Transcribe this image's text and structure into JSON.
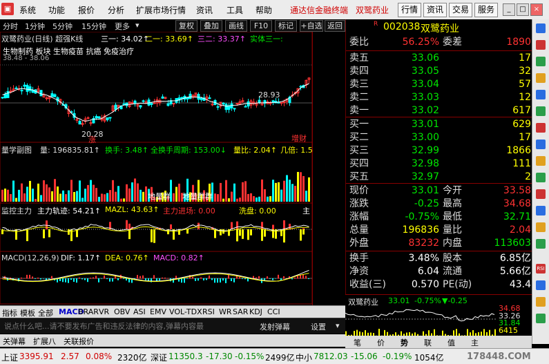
{
  "menu": {
    "items": [
      "系统",
      "功能",
      "报价",
      "分析",
      "扩展市场行情",
      "资讯",
      "工具",
      "帮助"
    ],
    "brand_text": "通达信金融终端",
    "stock_title": "双鹭药业",
    "buttons": [
      "行情",
      "资讯",
      "交易",
      "服务"
    ]
  },
  "toolbar2": {
    "periods": [
      "分时",
      "1分钟",
      "5分钟",
      "15分钟",
      "更多"
    ],
    "buttons": [
      "复权",
      "叠加",
      "画线",
      "F10",
      "标记",
      "+自选",
      "返回"
    ]
  },
  "chart": {
    "header": "双鹭药业(日线) 超强K线",
    "ma1": "三一: 34.02↑",
    "ma2": "二一: 33.69↑",
    "ma3": "三二: 33.37↑",
    "ma4": "实体三一:",
    "concept": "生物制药 板块 生物疫苗 抗癌 免疫治疗",
    "price_range": "38.48 - 38.06",
    "marker_high": "28.93",
    "marker_low": "20.28",
    "tag1": "涨",
    "tag2": "增财",
    "sub1_title": "量学副图",
    "sub1_vol": "量: 196835.81↑",
    "sub1_turnover": "换手: 3.48↑",
    "sub1_cycle": "全换手周期: 153.00↓",
    "sub1_ratio": "量比: 2.04↑",
    "sub1_multiple": "几倍: 1.5",
    "sub1_note1": "地量群",
    "sub1_note2": "地量群群",
    "sub2_title": "监控主力",
    "sub2_trace": "主力轨迹: 54.21↑",
    "sub2_mazl": "MAZL: 43.63↑",
    "sub2_enter": "主力进场: 0.00",
    "sub2_wash": "洗盘: 0.00",
    "sub2_main": "主",
    "macd_title": "MACD(12,26,9)",
    "macd_dif": "DIF: 1.17↑",
    "macd_dea": "DEA: 0.76↑",
    "macd_val": "MACD: 0.82↑",
    "date_label": "日线"
  },
  "colors": {
    "up": "#ff3232",
    "down": "#00ffff",
    "green": "#00e600",
    "yellow": "#ffff00",
    "magenta": "#ff50ff",
    "white": "#ffffff"
  },
  "quote": {
    "code": "002038",
    "name": "双鹭药业",
    "weibi_label": "委比",
    "weibi": "56.25%",
    "weicha_label": "委差",
    "weicha": "1890",
    "asks": [
      {
        "label": "卖五",
        "price": "33.06",
        "vol": "17"
      },
      {
        "label": "卖四",
        "price": "33.05",
        "vol": "32"
      },
      {
        "label": "卖三",
        "price": "33.04",
        "vol": "57"
      },
      {
        "label": "卖二",
        "price": "33.03",
        "vol": "12"
      },
      {
        "label": "卖一",
        "price": "33.02",
        "vol": "617"
      }
    ],
    "bids": [
      {
        "label": "买一",
        "price": "33.01",
        "vol": "629"
      },
      {
        "label": "买二",
        "price": "33.00",
        "vol": "17"
      },
      {
        "label": "买三",
        "price": "32.99",
        "vol": "1866"
      },
      {
        "label": "买四",
        "price": "32.98",
        "vol": "111"
      },
      {
        "label": "买五",
        "price": "32.97",
        "vol": "2"
      }
    ],
    "stats": [
      {
        "l1": "现价",
        "v1": "33.01",
        "l2": "今开",
        "v2": "33.58"
      },
      {
        "l1": "涨跌",
        "v1": "-0.25",
        "l2": "最高",
        "v2": "34.68"
      },
      {
        "l1": "涨幅",
        "v1": "-0.75%",
        "l2": "最低",
        "v2": "32.71"
      },
      {
        "l1": "总量",
        "v1": "196836",
        "l2": "量比",
        "v2": "2.04"
      },
      {
        "l1": "外盘",
        "v1": "83232",
        "l2": "内盘",
        "v2": "113603"
      }
    ],
    "finance": [
      {
        "l1": "换手",
        "v1": "3.48%",
        "l2": "股本",
        "v2": "6.85亿"
      },
      {
        "l1": "净资",
        "v1": "6.04",
        "l2": "流通",
        "v2": "5.66亿"
      },
      {
        "l1": "收益(三)",
        "v1": "0.570",
        "l2": "PE(动)",
        "v2": "43.4"
      }
    ],
    "mini_title": "双鹭药业",
    "mini_price": "33.01",
    "mini_pct": "-0.75%",
    "mini_change": "▼-0.25",
    "mini_high": "34.68",
    "mini_mid": "33.26",
    "mini_low": "31.84",
    "mini_vol": "6415",
    "mini_tabs": [
      "笔",
      "价",
      "势",
      "联",
      "值",
      "主"
    ]
  },
  "bottom": {
    "tabs": [
      "指标",
      "模板",
      "全部",
      "MACD",
      "BRAR",
      "VR",
      "OBV",
      "ASI",
      "EMV",
      "VOL-TDX",
      "RSI",
      "WR",
      "SAR",
      "KDJ",
      "CCI"
    ],
    "comment_placeholder": "说点什么吧...请不要发布广告和违反法律的内容,弹幕内容最",
    "send_btn": "发射弹幕",
    "settings": "设置",
    "bar2": [
      "关弹幕",
      "扩展八",
      "关联报价"
    ]
  },
  "status": {
    "sh_label": "上证",
    "sh_index": "3395.91",
    "sh_change": "2.57",
    "sh_pct": "0.08%",
    "sh_amount": "2320亿",
    "sz_label": "深证",
    "sz_index": "11350.3",
    "sz_change": "-17.30",
    "sz_pct": "-0.15%",
    "sz_amount": "2499亿",
    "zx_label": "中小",
    "zx_index": "7812.03",
    "zx_change": "-15.06",
    "zx_pct": "-0.19%",
    "zx_amount": "1054亿",
    "watermark": "178448.COM"
  }
}
